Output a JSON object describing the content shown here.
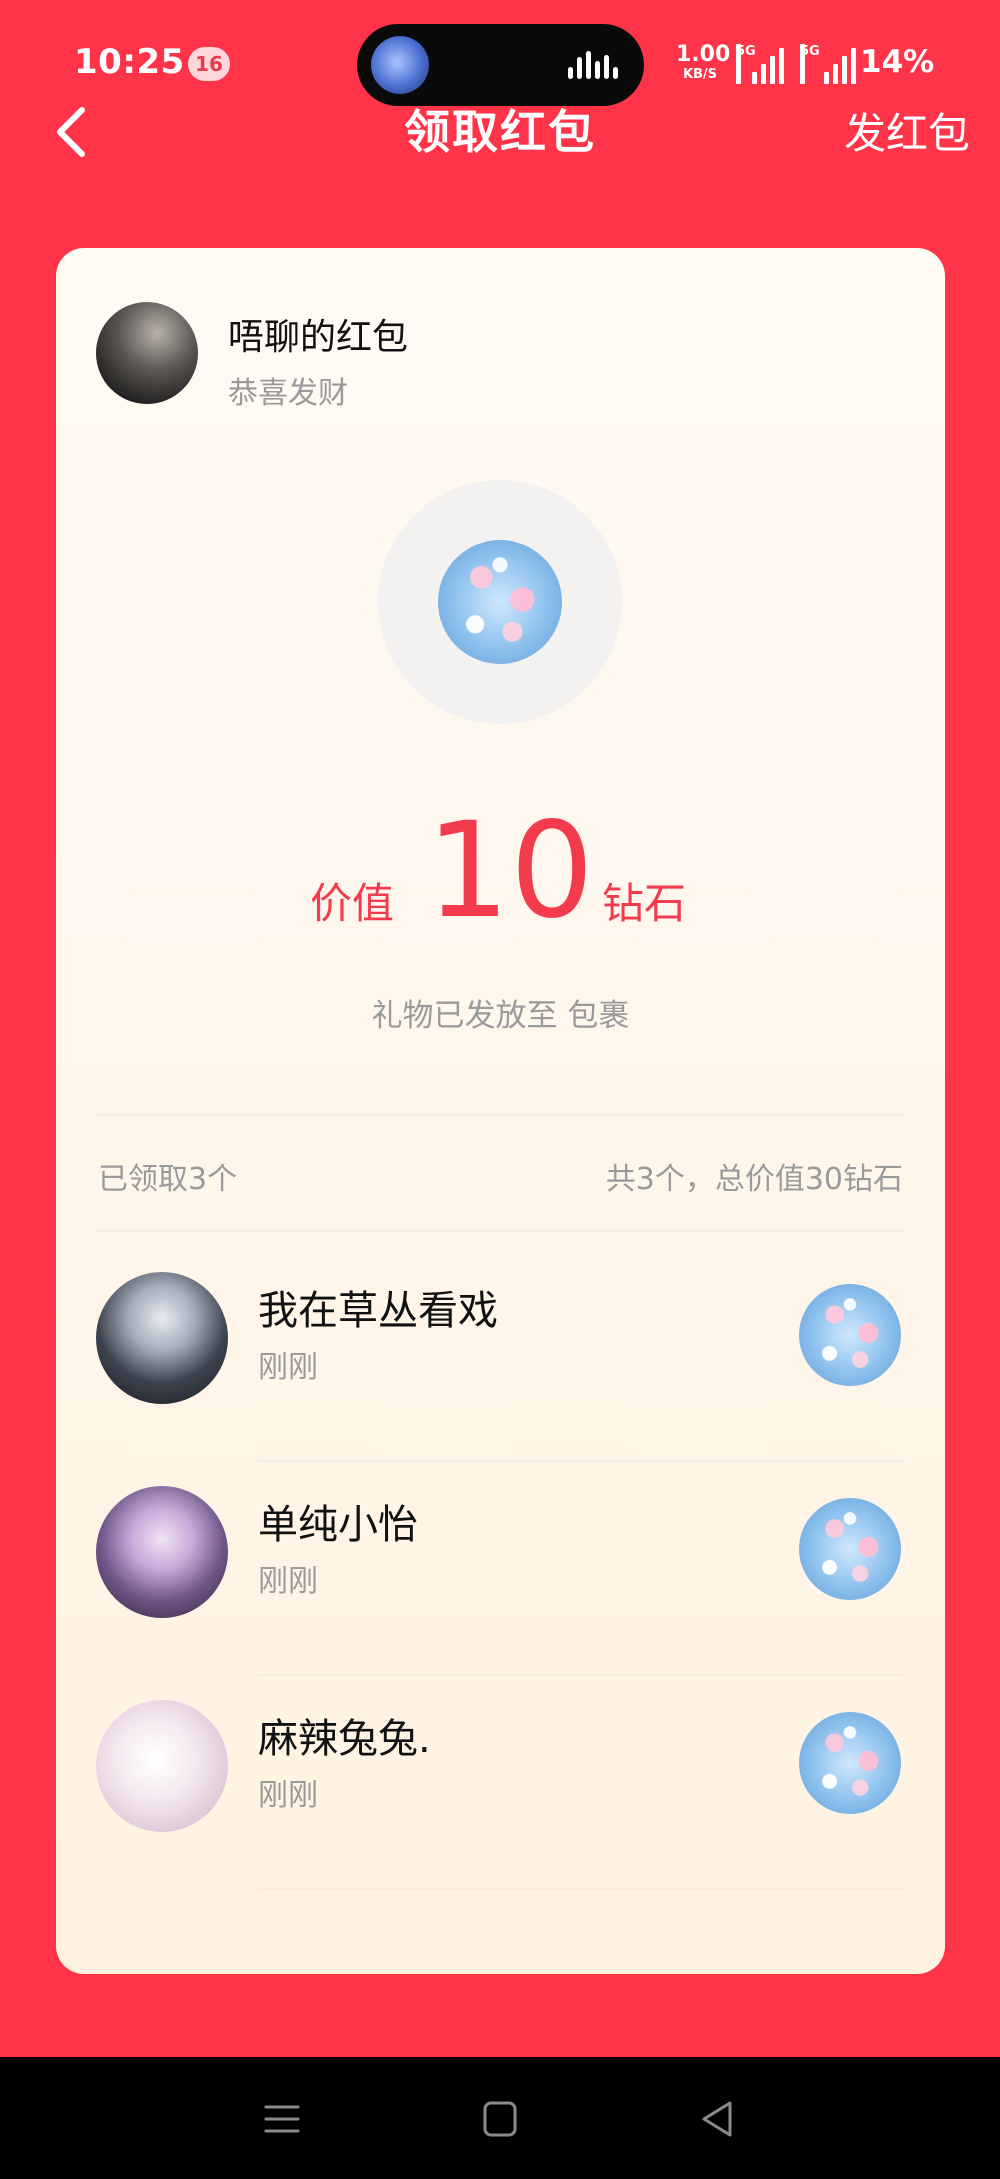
{
  "status_bar": {
    "time": "10:25",
    "notification_count": "16",
    "net_speed_value": "1.00",
    "net_speed_unit": "KB/S",
    "signal_1_label": "5G",
    "signal_2_label": "5G",
    "battery": "14%"
  },
  "header": {
    "title": "领取红包",
    "send_button": "发红包"
  },
  "card": {
    "sender_name": "唔聊的红包",
    "blessing": "恭喜发财",
    "value_prefix": "价值",
    "value_number": "10",
    "value_unit": "钻石",
    "delivered_note": "礼物已发放至 包裹",
    "summary_left": "已领取3个",
    "summary_right": "共3个，总价值30钻石"
  },
  "claims": [
    {
      "name": "我在草丛看戏",
      "time": "刚刚"
    },
    {
      "name": "单纯小怡",
      "time": "刚刚"
    },
    {
      "name": "麻辣兔兔.",
      "time": "刚刚"
    }
  ],
  "colors": {
    "page_background": "#ff3448",
    "value_red": "#f23c4e",
    "card_background": "#fffaf4"
  },
  "icons": {
    "back": "chevron-left-icon",
    "nav_menu": "menu-icon",
    "nav_home": "square-icon",
    "nav_back": "triangle-back-icon"
  }
}
